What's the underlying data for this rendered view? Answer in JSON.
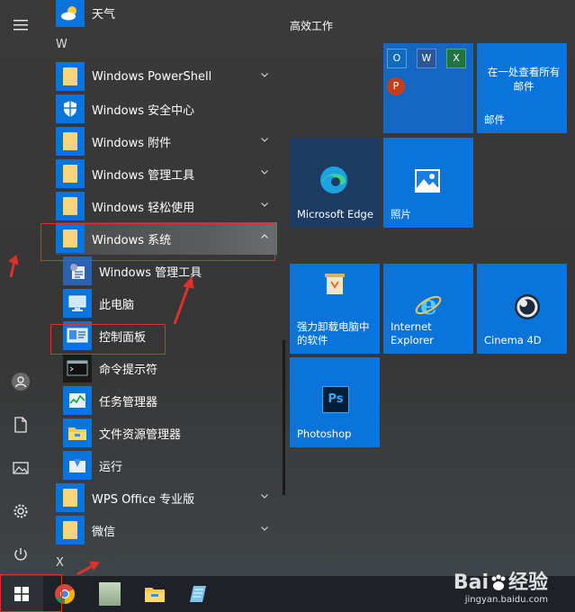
{
  "top_item": {
    "label": "天气"
  },
  "letters": {
    "w": "W",
    "x": "X"
  },
  "apps": {
    "powershell": "Windows PowerShell",
    "security": "Windows 安全中心",
    "accessories": "Windows 附件",
    "admin_tools": "Windows 管理工具",
    "ease_access": "Windows 轻松使用",
    "system": "Windows 系统",
    "sys_admin_tools": "Windows 管理工具",
    "this_pc": "此电脑",
    "control_panel": "控制面板",
    "cmd": "命令提示符",
    "task_manager": "任务管理器",
    "explorer": "文件资源管理器",
    "run": "运行",
    "wps": "WPS Office 专业版",
    "wechat": "微信"
  },
  "tiles": {
    "group_title": "高效工作",
    "mail_text": "在一处查看所有邮件",
    "mail_label": "邮件",
    "edge": "Microsoft Edge",
    "photos": "照片",
    "uninstall": "强力卸载电脑中的软件",
    "ie": "Internet Explorer",
    "c4d": "Cinema 4D",
    "photoshop": "Photoshop"
  },
  "office_letters": {
    "outlook": "O",
    "word": "W",
    "excel": "X",
    "ppt": "P"
  },
  "ps_logo": "Ps",
  "watermark": {
    "brand_a": "Bai",
    "brand_b": "经验",
    "url": "jingyan.baidu.com"
  },
  "colors": {
    "tile_blue": "#0a74da",
    "highlight_red": "#e0302a",
    "accent": "#1e6fb8"
  }
}
